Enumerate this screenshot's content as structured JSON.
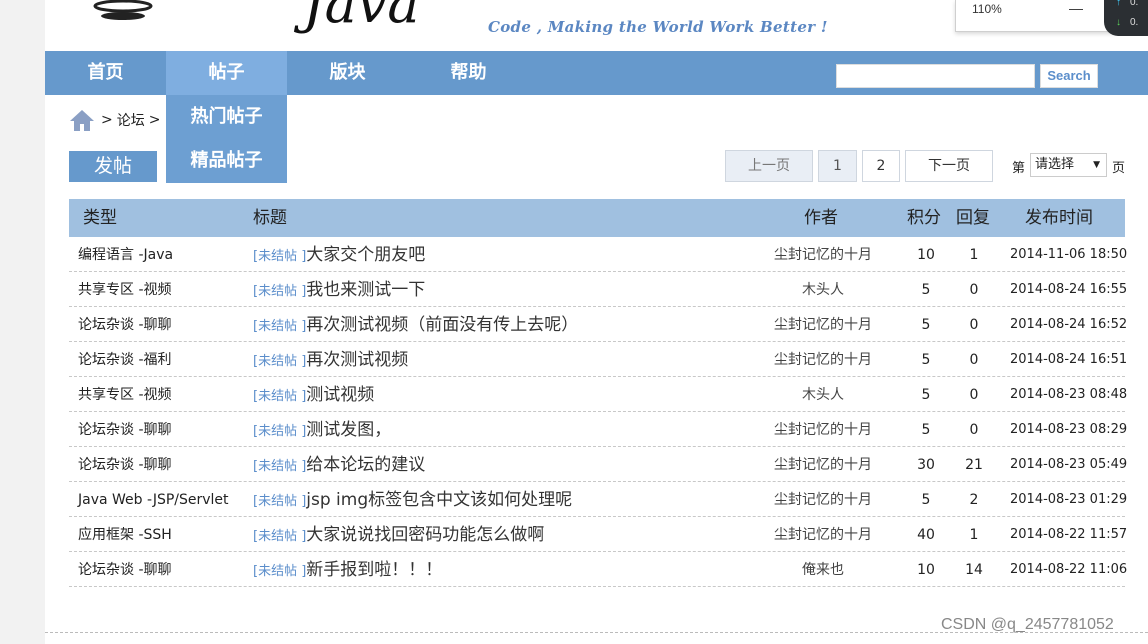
{
  "header": {
    "logo_text": "Java",
    "slogan": "Code , Making the World Work Better !"
  },
  "zoom": {
    "value": "110%",
    "minus": "—"
  },
  "net_widget": {
    "up": "↑",
    "down": "↓",
    "up_val": "0.",
    "down_val": "0."
  },
  "nav": {
    "items": [
      {
        "label": "首页"
      },
      {
        "label": "帖子"
      },
      {
        "label": "版块"
      },
      {
        "label": "帮助"
      }
    ],
    "search_placeholder": "",
    "search_button": "Search",
    "dropdown": [
      {
        "label": "热门帖子"
      },
      {
        "label": "精品帖子"
      }
    ]
  },
  "breadcrumb": {
    "sep1": ">",
    "forum": "论坛",
    "sep2": ">"
  },
  "post_button": "发帖",
  "pager": {
    "prev": "上一页",
    "pages": [
      "1",
      "2"
    ],
    "next": "下一页",
    "prefix": "第",
    "select_value": "请选择",
    "suffix": "页"
  },
  "table": {
    "headers": {
      "type": "类型",
      "title": "标题",
      "author": "作者",
      "score": "积分",
      "reply": "回复",
      "time": "发布时间"
    },
    "rows": [
      {
        "type": "编程语言 -Java",
        "tag": "[未结帖 ]",
        "title": "大家交个朋友吧",
        "author": "尘封记忆的十月",
        "score": "10",
        "reply": "1",
        "time": "2014-11-06 18:50"
      },
      {
        "type": "共享专区 -视频",
        "tag": "[未结帖 ]",
        "title": "我也来测试一下",
        "author": "木头人",
        "score": "5",
        "reply": "0",
        "time": "2014-08-24 16:55"
      },
      {
        "type": "论坛杂谈 -聊聊",
        "tag": "[未结帖 ]",
        "title": "再次测试视频（前面没有传上去呢）",
        "author": "尘封记忆的十月",
        "score": "5",
        "reply": "0",
        "time": "2014-08-24 16:52"
      },
      {
        "type": "论坛杂谈 -福利",
        "tag": "[未结帖 ]",
        "title": "再次测试视频",
        "author": "尘封记忆的十月",
        "score": "5",
        "reply": "0",
        "time": "2014-08-24 16:51"
      },
      {
        "type": "共享专区 -视频",
        "tag": "[未结帖 ]",
        "title": "测试视频",
        "author": "木头人",
        "score": "5",
        "reply": "0",
        "time": "2014-08-23 08:48"
      },
      {
        "type": "论坛杂谈 -聊聊",
        "tag": "[未结帖 ]",
        "title": "测试发图，",
        "author": "尘封记忆的十月",
        "score": "5",
        "reply": "0",
        "time": "2014-08-23 08:29"
      },
      {
        "type": "论坛杂谈 -聊聊",
        "tag": "[未结帖 ]",
        "title": "给本论坛的建议",
        "author": "尘封记忆的十月",
        "score": "30",
        "reply": "21",
        "time": "2014-08-23 05:49"
      },
      {
        "type": "Java Web -JSP/Servlet",
        "tag": "[未结帖 ]",
        "title": "jsp img标签包含中文该如何处理呢",
        "author": "尘封记忆的十月",
        "score": "5",
        "reply": "2",
        "time": "2014-08-23 01:29"
      },
      {
        "type": "应用框架 -SSH",
        "tag": "[未结帖 ]",
        "title": "大家说说找回密码功能怎么做啊",
        "author": "尘封记忆的十月",
        "score": "40",
        "reply": "1",
        "time": "2014-08-22 11:57"
      },
      {
        "type": "论坛杂谈 -聊聊",
        "tag": "[未结帖 ]",
        "title": "新手报到啦！！！",
        "author": "俺来也",
        "score": "10",
        "reply": "14",
        "time": "2014-08-22 11:06"
      }
    ]
  },
  "watermark": "CSDN @q_2457781052",
  "colors": {
    "nav": "#6699cc",
    "nav_active": "#7faee0",
    "table_header": "#a0c0e0",
    "tag": "#5b8ecb"
  }
}
